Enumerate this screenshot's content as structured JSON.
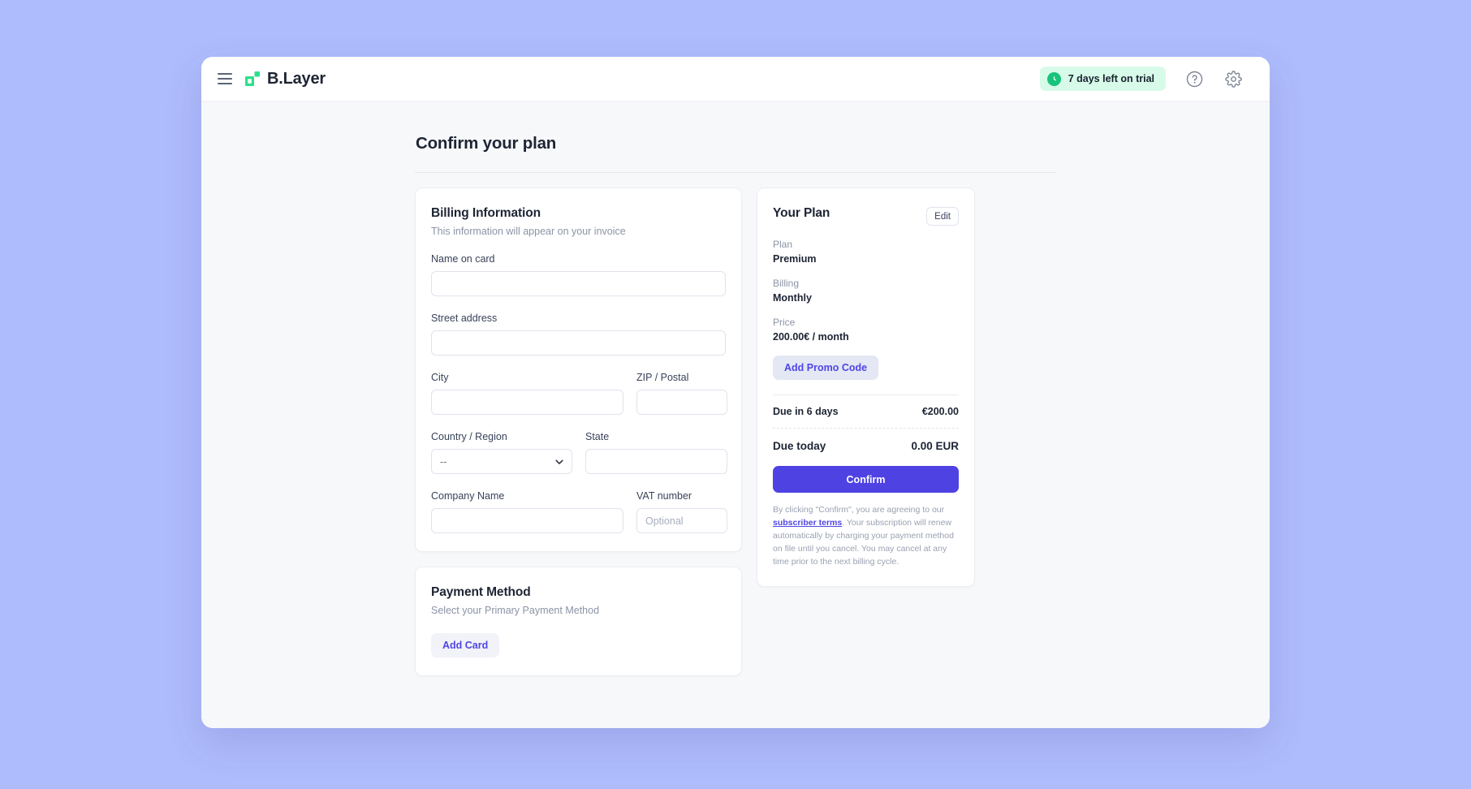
{
  "topbar": {
    "menu_icon": "hamburger-menu-icon",
    "brand_name": "B.Layer",
    "brand_mark_icon": "blayer-logo-icon",
    "brand_mark_color": "#18c37d",
    "trial_badge": {
      "icon": "clock-icon",
      "label": "7 days left on trial",
      "background": "#d7fbe8",
      "icon_background": "#18c37d"
    },
    "help_icon": "help-circle-icon",
    "settings_icon": "gear-icon"
  },
  "page": {
    "title": "Confirm your plan"
  },
  "billing": {
    "title": "Billing Information",
    "subtitle": "This information will appear on your invoice",
    "fields": {
      "name_on_card": {
        "label": "Name on card",
        "value": "",
        "placeholder": ""
      },
      "street_address": {
        "label": "Street address",
        "value": "",
        "placeholder": ""
      },
      "city": {
        "label": "City",
        "value": "",
        "placeholder": ""
      },
      "zip": {
        "label": "ZIP / Postal",
        "value": "",
        "placeholder": ""
      },
      "country": {
        "label": "Country / Region",
        "value": "--",
        "chevron_icon": "chevron-down-icon"
      },
      "state": {
        "label": "State",
        "value": "",
        "placeholder": ""
      },
      "company_name": {
        "label": "Company Name",
        "value": "",
        "placeholder": ""
      },
      "vat_number": {
        "label": "VAT number",
        "value": "",
        "placeholder": "Optional"
      }
    }
  },
  "payment_method": {
    "title": "Payment Method",
    "subtitle": "Select your Primary Payment Method",
    "add_card_label": "Add Card"
  },
  "plan": {
    "title": "Your Plan",
    "edit_label": "Edit",
    "rows": [
      {
        "key": "Plan",
        "value": "Premium"
      },
      {
        "key": "Billing",
        "value": "Monthly"
      },
      {
        "key": "Price",
        "value": "200.00€ / month"
      }
    ],
    "promo_label": "Add Promo Code",
    "due_later": {
      "label": "Due in 6 days",
      "amount": "€200.00"
    },
    "due_today": {
      "label": "Due today",
      "amount": "0.00 EUR"
    },
    "confirm_label": "Confirm",
    "confirm_color": "#4f42e3",
    "terms": {
      "before": "By clicking \"Confirm\", you are agreeing to our ",
      "link": "subscriber terms",
      "after": ". Your subscription will renew automatically by charging your payment method on file until you cancel. You may cancel at any time prior to the next billing cycle."
    }
  }
}
